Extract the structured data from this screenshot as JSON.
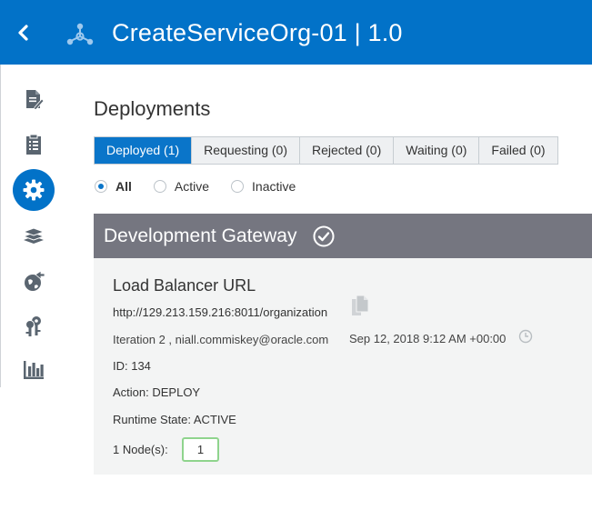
{
  "header": {
    "title": "CreateServiceOrg-01 | 1.0",
    "background": "#0272c8",
    "back_icon": "chevron-left-icon",
    "logo_icon": "api-network-icon"
  },
  "sidebar": {
    "items": [
      {
        "name": "api-implementation",
        "icon": "document-edit-icon",
        "active": false
      },
      {
        "name": "api-grants",
        "icon": "clipboard-list-icon",
        "active": false
      },
      {
        "name": "deployments",
        "icon": "gear-icon",
        "active": true
      },
      {
        "name": "applications",
        "icon": "layers-icon",
        "active": false
      },
      {
        "name": "publication",
        "icon": "globe-arrow-icon",
        "active": false
      },
      {
        "name": "grants",
        "icon": "keys-icon",
        "active": false
      },
      {
        "name": "analytics",
        "icon": "bar-chart-icon",
        "active": false
      }
    ]
  },
  "main": {
    "title": "Deployments",
    "tabs": [
      {
        "label": "Deployed (1)",
        "active": true
      },
      {
        "label": "Requesting (0)",
        "active": false
      },
      {
        "label": "Rejected (0)",
        "active": false
      },
      {
        "label": "Waiting (0)",
        "active": false
      },
      {
        "label": "Failed (0)",
        "active": false
      }
    ],
    "filter": {
      "options": [
        "All",
        "Active",
        "Inactive"
      ],
      "selected": "All"
    },
    "gateway": {
      "name": "Development Gateway",
      "status_icon": "check-circle-icon",
      "bar_color": "#757680"
    },
    "deployment": {
      "lb_title": "Load Balancer URL",
      "lb_url": "http://129.213.159.216:8011/organization",
      "iteration": "Iteration 2 , niall.commiskey@oracle.com",
      "date": "Sep 12, 2018 9:12 AM +00:00",
      "id": "ID: 134",
      "action": "Action: DEPLOY",
      "runtime_state": "Runtime State: ACTIVE",
      "nodes_label": "1 Node(s):",
      "nodes_value": "1"
    }
  }
}
